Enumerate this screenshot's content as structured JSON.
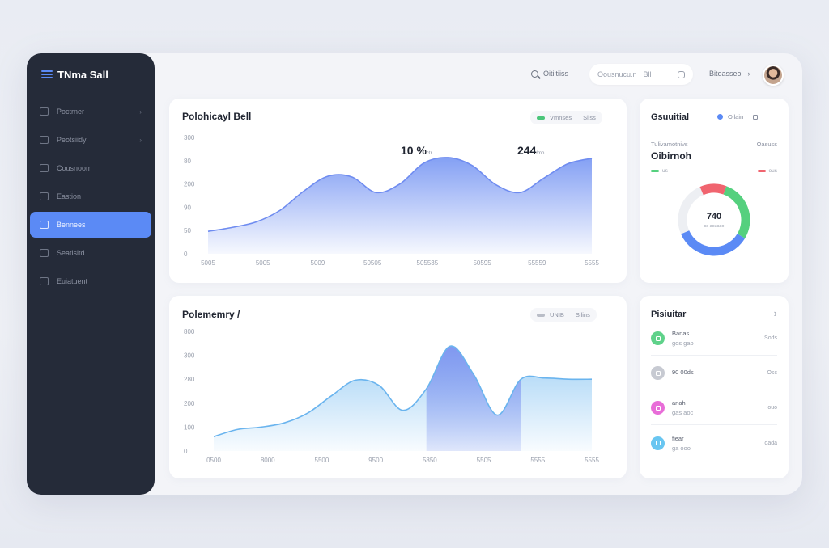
{
  "app": {
    "brand": "TNma Sall"
  },
  "sidebar": {
    "items": [
      {
        "label": "Poctrner",
        "icon": "grid-icon",
        "chevron": true,
        "active": false
      },
      {
        "label": "Peotsiidy",
        "icon": "clock-icon",
        "chevron": true,
        "active": false
      },
      {
        "label": "Cousnoom",
        "icon": "chart-icon",
        "chevron": false,
        "active": false
      },
      {
        "label": "Eastion",
        "icon": "calendar-icon",
        "chevron": false,
        "active": false
      },
      {
        "label": "Bennees",
        "icon": "folder-icon",
        "chevron": false,
        "active": true
      },
      {
        "label": "Seatisitd",
        "icon": "inbox-icon",
        "chevron": false,
        "active": false
      },
      {
        "label": "Euiatuent",
        "icon": "document-icon",
        "chevron": false,
        "active": false
      }
    ]
  },
  "topbar": {
    "search_label": "Oitiltiiss",
    "search_placeholder": "Oousnucu.n · Bll",
    "user_name": "Bitoasseo",
    "chevron": "›"
  },
  "chart1": {
    "title": "Polohicayl Bell",
    "legend_primary": "Vmnses",
    "legend_secondary": "Siiss",
    "ann_left": "10 %",
    "ann_left_small": "ctr",
    "ann_right": "244",
    "ann_right_small": "/mo",
    "colors": {
      "accent": "#5b7ff0",
      "ann_left": "#e05565",
      "ann_right": "#3fb36f"
    }
  },
  "chart2": {
    "title": "Polememry /",
    "legend_primary": "UNIB",
    "legend_secondary": "Silins",
    "colors": {
      "area": "#8fc8f3",
      "highlight": "#7f95f0"
    }
  },
  "chart_data": [
    {
      "type": "area",
      "title": "Polohicayl Bell",
      "y_ticks": [
        "300",
        "80",
        "200",
        "90",
        "50",
        "0"
      ],
      "x_ticks": [
        "5005",
        "5005",
        "5009",
        "50505",
        "505535",
        "50595",
        "55559",
        "5555"
      ],
      "ylim": [
        0,
        300
      ],
      "x": [
        0,
        1,
        2,
        3,
        4,
        5,
        6,
        7,
        8,
        9,
        10,
        11,
        12,
        13,
        14,
        15,
        16
      ],
      "values": [
        58,
        68,
        82,
        112,
        162,
        200,
        198,
        158,
        180,
        234,
        248,
        228,
        178,
        158,
        195,
        232,
        246
      ],
      "grid": false,
      "legend": "top-right"
    },
    {
      "type": "area",
      "title": "Polememry /",
      "y_ticks": [
        "800",
        "300",
        "280",
        "200",
        "100",
        "0"
      ],
      "x_ticks": [
        "0500",
        "8000",
        "5500",
        "9500",
        "5850",
        "5505",
        "5555",
        "5555"
      ],
      "ylim": [
        0,
        500
      ],
      "x": [
        0,
        1,
        2,
        3,
        4,
        5,
        6,
        7,
        8,
        9,
        10,
        11,
        12,
        13,
        14,
        15,
        16
      ],
      "values": [
        60,
        90,
        100,
        118,
        160,
        232,
        296,
        274,
        170,
        260,
        438,
        320,
        150,
        300,
        305,
        300,
        300
      ],
      "highlight_range": [
        9,
        13
      ],
      "grid": false,
      "legend": "top-right"
    },
    {
      "type": "pie",
      "title": "Gsuuitial",
      "categories": [
        "Blue",
        "Green",
        "Red",
        "Gray"
      ],
      "values": [
        35,
        28,
        12,
        25
      ],
      "colors": [
        "#5b8af5",
        "#55d07e",
        "#f0646f",
        "#edeff3"
      ],
      "center_value": "740",
      "center_label": "ss asuaso"
    }
  ],
  "donut_card": {
    "title": "Gsuuitial",
    "legend_label": "Oilain",
    "subtitle_left": "Tulivamotnivs",
    "subtitle_right": "Oasuss",
    "heading": "Oibirnoh",
    "mini_left": "us",
    "mini_right": "ous",
    "mini_colors": {
      "left": "#55d07e",
      "right": "#f0646f"
    },
    "legend_color": "#5b8af5"
  },
  "list_card": {
    "title": "Pisiuitar",
    "chevron": "›",
    "items": [
      {
        "title": "Banas",
        "sub": "gos gao",
        "meta": "Sods",
        "color": "#5fd28a",
        "icon": "check-icon"
      },
      {
        "title": "90 00ds",
        "sub": "",
        "meta": "Osc",
        "color": "#c7cad2",
        "icon": "clock-icon"
      },
      {
        "title": "anah",
        "sub": "gas aoc",
        "meta": "ouo",
        "color": "#e86dd8",
        "icon": "tag-icon"
      },
      {
        "title": "fiear",
        "sub": "ga ooo",
        "meta": "oada",
        "color": "#69c6f1",
        "icon": "bolt-icon"
      }
    ]
  }
}
